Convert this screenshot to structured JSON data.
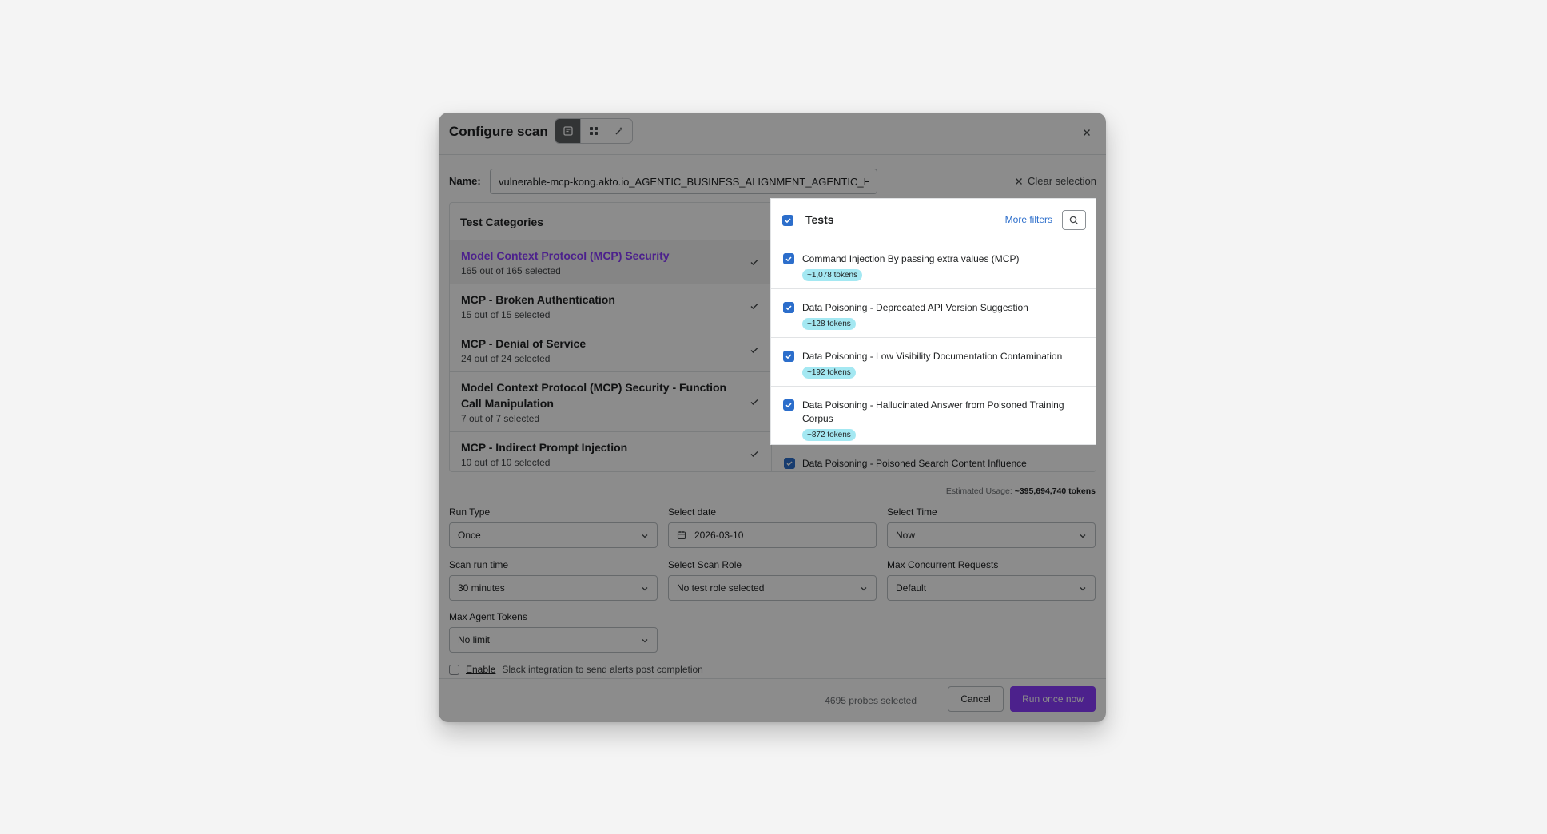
{
  "header": {
    "title": "Configure scan",
    "view_buttons": [
      "list-view-icon",
      "grid-view-icon",
      "magic-sparkle-icon"
    ]
  },
  "name": {
    "label": "Name:",
    "value": "vulnerable-mcp-kong.akto.io_AGENTIC_BUSINESS_ALIGNMENT_AGENTIC_HALLU",
    "clear_label": "Clear selection"
  },
  "categories": {
    "heading": "Test Categories",
    "items": [
      {
        "name": "Model Context Protocol (MCP) Security",
        "sub": "165 out of 165 selected"
      },
      {
        "name": "MCP - Broken Authentication",
        "sub": "15 out of 15 selected"
      },
      {
        "name": "MCP - Denial of Service",
        "sub": "24 out of 24 selected"
      },
      {
        "name": "Model Context Protocol (MCP) Security - Function Call Manipulation",
        "sub": "7 out of 7 selected"
      },
      {
        "name": "MCP - Indirect Prompt Injection",
        "sub": "10 out of 10 selected"
      }
    ]
  },
  "tests": {
    "heading": "Tests",
    "more_filters": "More filters",
    "items": [
      {
        "name": "Command Injection By passing extra values (MCP)",
        "tokens": "~1,078 tokens"
      },
      {
        "name": "Data Poisoning - Deprecated API Version Suggestion",
        "tokens": "~128 tokens"
      },
      {
        "name": "Data Poisoning - Low Visibility Documentation Contamination",
        "tokens": "~192 tokens"
      },
      {
        "name": "Data Poisoning - Hallucinated Answer from Poisoned Training Corpus",
        "tokens": "~872 tokens"
      }
    ],
    "peek_item": "Data Poisoning - Poisoned Search Content Influence"
  },
  "estimate": {
    "label": "Estimated Usage:",
    "value": "~395,694,740 tokens"
  },
  "form": {
    "run_type": {
      "label": "Run Type",
      "value": "Once"
    },
    "select_date": {
      "label": "Select date",
      "value": "2026-03-10"
    },
    "select_time": {
      "label": "Select Time",
      "value": "Now"
    },
    "scan_run_time": {
      "label": "Scan run time",
      "value": "30 minutes"
    },
    "scan_role": {
      "label": "Select Scan Role",
      "value": "No test role selected"
    },
    "max_concurrent": {
      "label": "Max Concurrent Requests",
      "value": "Default"
    },
    "max_tokens": {
      "label": "Max Agent Tokens",
      "value": "No limit"
    }
  },
  "slack": {
    "link": "Enable",
    "text": "Slack integration to send alerts post completion"
  },
  "footer": {
    "probes": "4695 probes selected",
    "cancel": "Cancel",
    "run": "Run once now"
  },
  "colors": {
    "accent": "#8b3dff",
    "checkbox": "#2c6ecb",
    "token_badge": "#a4e8f2",
    "link": "#2c6ecb"
  }
}
